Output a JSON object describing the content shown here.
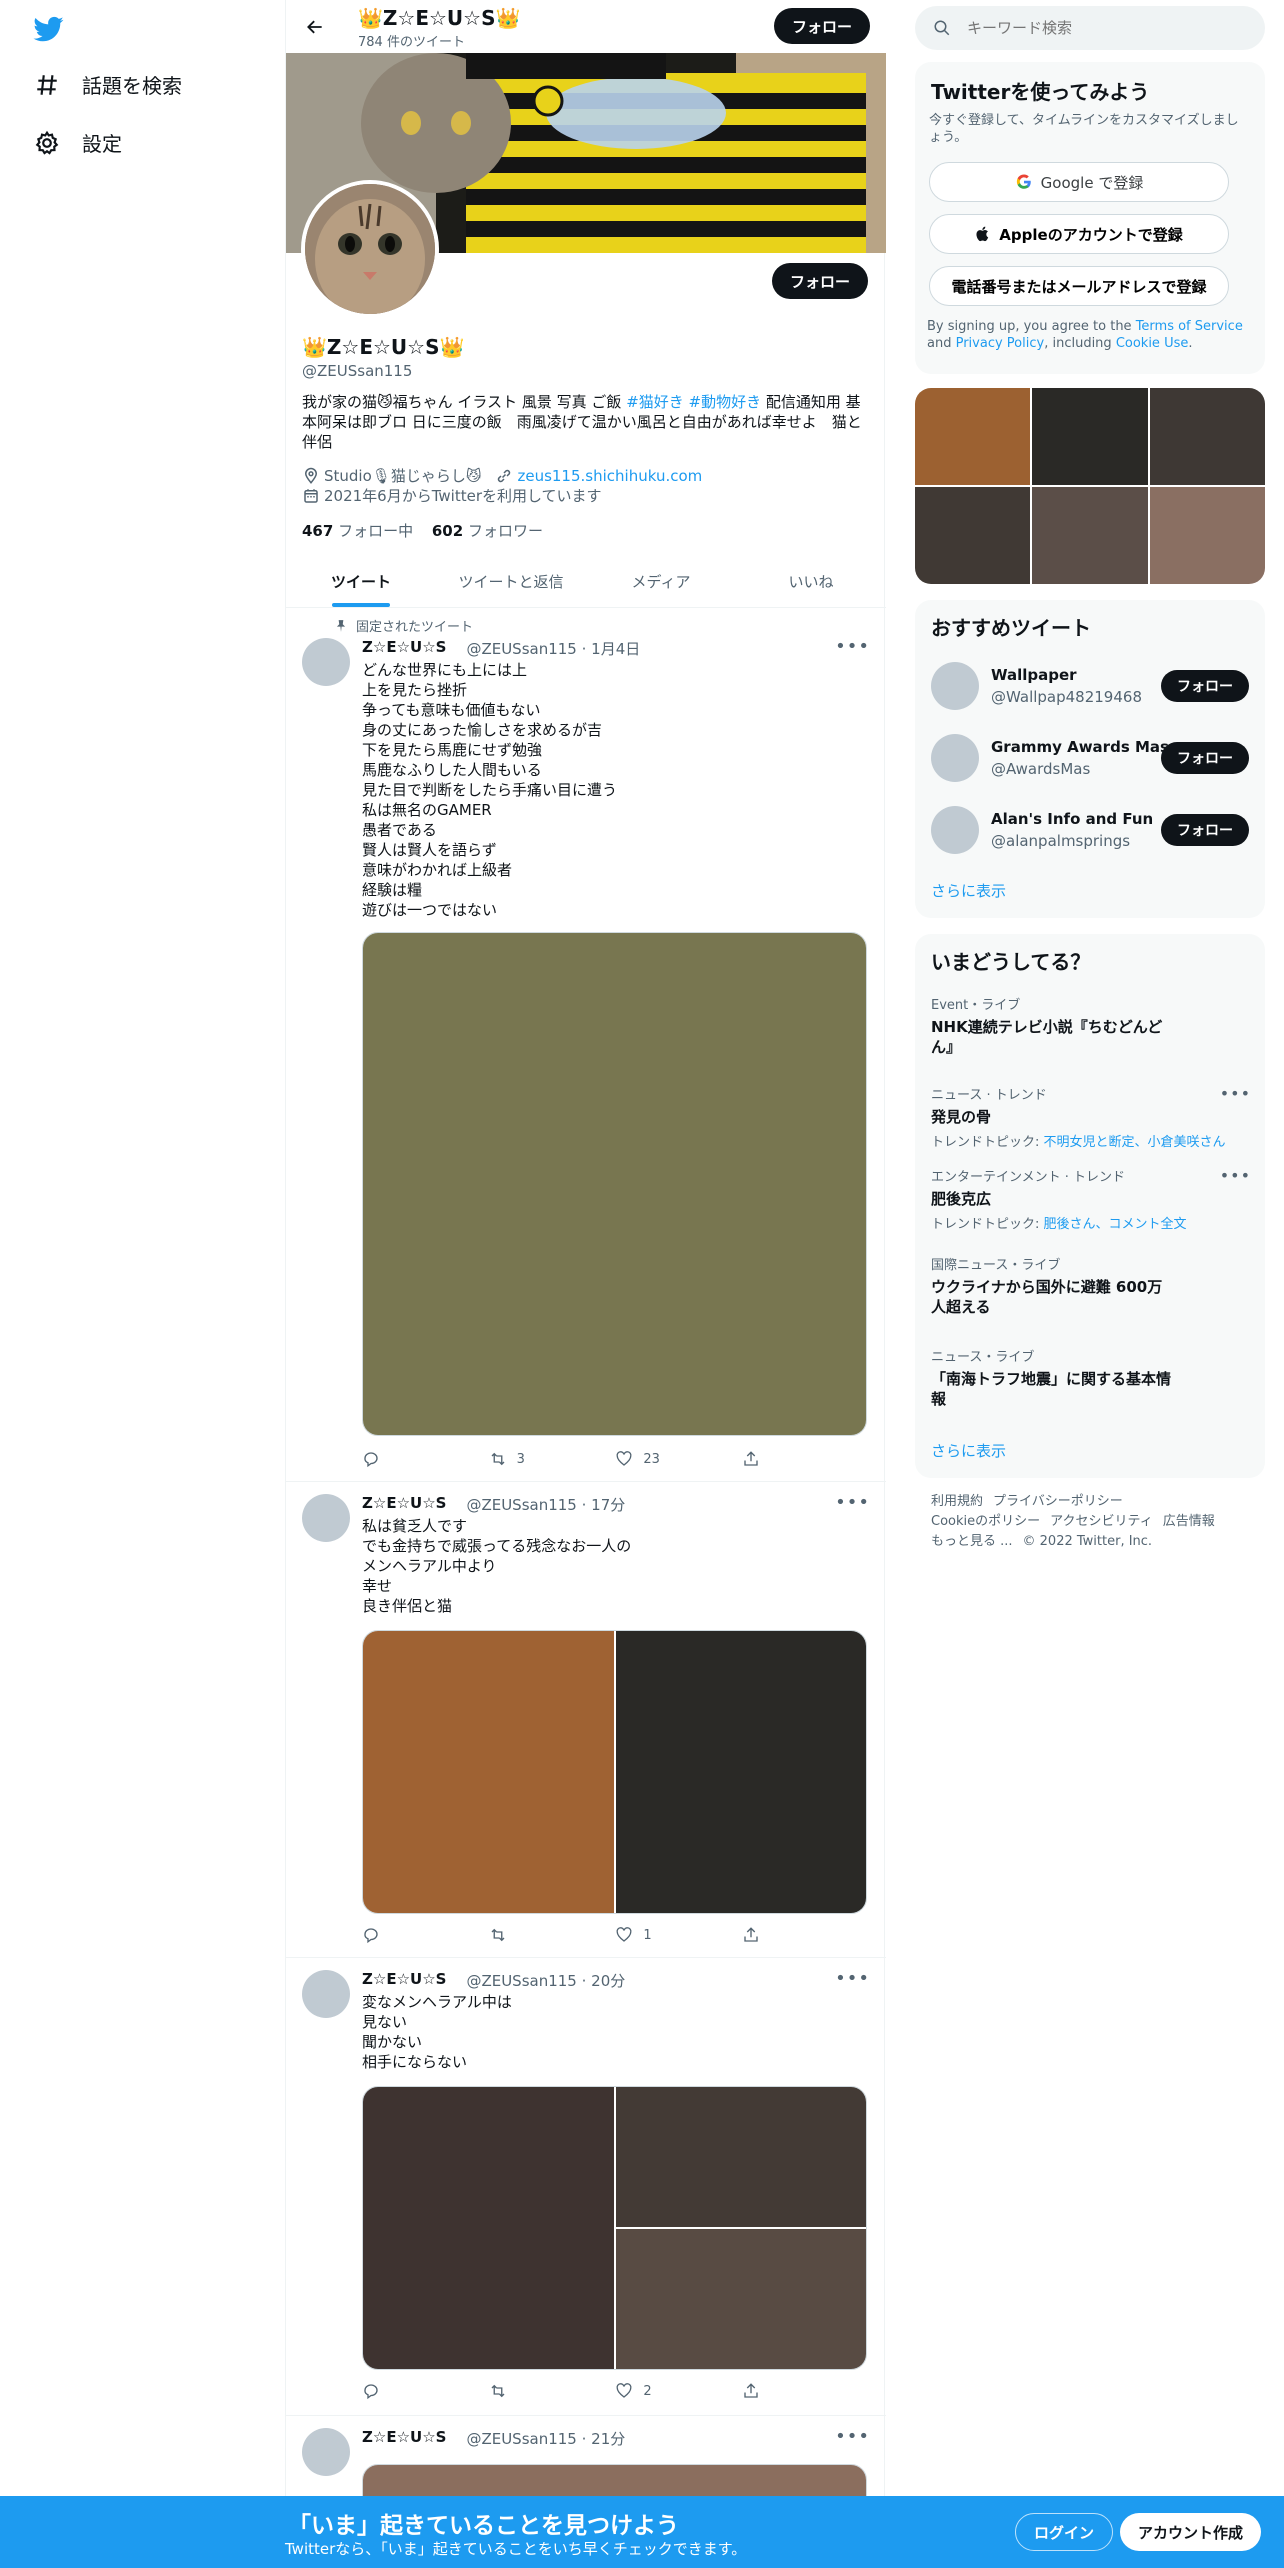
{
  "nav": {
    "explore": "話題を検索",
    "settings": "設定"
  },
  "header": {
    "name": "👑Z☆E☆U☆S👑",
    "tweet_count": "784 件のツイート",
    "follow": "フォロー"
  },
  "profile": {
    "name": "👑Z☆E☆U☆S👑",
    "handle": "@ZEUSsan115",
    "bio_pre": "我が家の猫😼福ちゃん イラスト 風景 写真 ご飯 ",
    "tag1": "#猫好き",
    "tag2": "#動物好き",
    "bio_post": " 配信通知用 基本阿呆は即ブロ 日に三度の飯　雨風凌げて温かい風呂と自由があれば幸せよ　猫と伴侶",
    "location": "Studio🎙猫じゃらし😼",
    "url": "zeus115.shichihuku.com",
    "joined": "2021年6月からTwitterを利用しています",
    "following_count": "467",
    "following_label": " フォロー中",
    "followers_count": "602",
    "followers_label": " フォロワー",
    "follow": "フォロー"
  },
  "tabs": [
    "ツイート",
    "ツイートと返信",
    "メディア",
    "いいね"
  ],
  "pinned_label": "固定されたツイート",
  "tweets": [
    {
      "name": "Z☆E☆U☆S",
      "meta": "@ZEUSsan115 · 1月4日",
      "text": "どんな世界にも上には上\n上を見たら挫折\n争っても意味も価値もない\n身の丈にあった愉しさを求めるが吉\n下を見たら馬鹿にせず勉強\n馬鹿なふりした人間もいる\n見た目で判断をしたら手痛い目に遭う\n私は無名のGAMER\n愚者である\n賢人は賢人を語らず\n意味がわかれば上級者\n経験は糧\n遊びは一つではない",
      "retweets": "3",
      "likes": "23"
    },
    {
      "name": "Z☆E☆U☆S",
      "meta": "@ZEUSsan115 · 17分",
      "text": "私は貧乏人です\nでも金持ちで威張ってる残念なお一人の\nメンヘラアル中より\n幸せ\n良き伴侶と猫",
      "retweets": "",
      "likes": "1"
    },
    {
      "name": "Z☆E☆U☆S",
      "meta": "@ZEUSsan115 · 20分",
      "text": "変なメンヘラアル中は\n見ない\n聞かない\n相手にならない",
      "retweets": "",
      "likes": "2"
    },
    {
      "name": "Z☆E☆U☆S",
      "meta": "@ZEUSsan115 · 21分"
    }
  ],
  "search": {
    "placeholder": "キーワード検索"
  },
  "signup": {
    "title": "Twitterを使ってみよう",
    "subtitle": "今すぐ登録して、タイムラインをカスタマイズしましょう。",
    "google": "Google で登録",
    "apple": "Appleのアカウントで登録",
    "phone": "電話番号またはメールアドレスで登録",
    "terms_pre": "By signing up, you agree to the ",
    "terms_link": "Terms of Service",
    "terms_mid": " and ",
    "privacy_link": "Privacy Policy",
    "terms_mid2": ", including ",
    "cookie_link": "Cookie Use",
    "terms_end": "."
  },
  "who_to_follow": {
    "title": "おすすめツイート",
    "accounts": [
      {
        "name": "Wallpaper",
        "handle": "@Wallpap48219468"
      },
      {
        "name": "Grammy Awards Mas",
        "handle": "@AwardsMas"
      },
      {
        "name": "Alan's Info and Fun",
        "handle": "@alanpalmsprings"
      }
    ],
    "follow": "フォロー",
    "show_more": "さらに表示"
  },
  "trends": {
    "title": "いまどうしてる？",
    "items": [
      {
        "category": "Event・ライブ",
        "title": "NHK連続テレビ小説『ちむどんどん』"
      },
      {
        "category": "ニュース · トレンド",
        "title": "発見の骨",
        "sub_label": "トレンドトピック: ",
        "sub_link": "不明女児と断定、小倉美咲さん"
      },
      {
        "category": "エンターテインメント · トレンド",
        "title": "肥後克広",
        "sub_label": "トレンドトピック: ",
        "sub_link": "肥後さん、コメント全文"
      },
      {
        "category": "国際ニュース・ライブ",
        "title": "ウクライナから国外に避難 600万人超える"
      },
      {
        "category": "ニュース・ライブ",
        "title": "「南海トラフ地震」に関する基本情報"
      }
    ],
    "show_more": "さらに表示"
  },
  "footer": {
    "links": [
      "利用規約",
      "プライバシーポリシー",
      "Cookieのポリシー",
      "アクセシビリティ",
      "広告情報",
      "もっと見る ..."
    ],
    "copyright": "© 2022 Twitter, Inc."
  },
  "bottom_bar": {
    "title": "「いま」起きていることを見つけよう",
    "subtitle": "Twitterなら、「いま」起きていることをいち早くチェックできます。",
    "login": "ログイン",
    "signup": "アカウント作成"
  },
  "colors": {
    "accent": "#1d9bf0",
    "media1": "#787650",
    "photo_grid": [
      "#9c6131",
      "#2a2926",
      "#3e3834",
      "#403934",
      "#5b4e48",
      "#8a6f62"
    ],
    "media2": [
      "#9f6233",
      "#2a2926"
    ],
    "media3": [
      "#3e3330",
      "#433a35",
      "#584b43"
    ],
    "media4": "#8b6e5e"
  }
}
